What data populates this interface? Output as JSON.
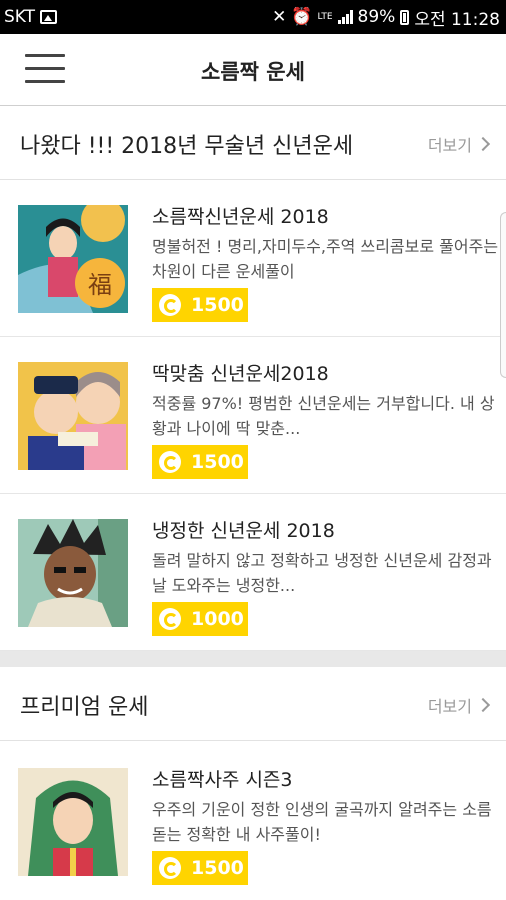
{
  "status_bar": {
    "carrier": "SKT",
    "lte": "LTE",
    "battery": "89%",
    "time": "오전 11:28"
  },
  "app_bar": {
    "title": "소름짝 운세"
  },
  "sections": [
    {
      "title": "나왔다 !!! 2018년 무술년 신년운세",
      "more": "더보기",
      "items": [
        {
          "title": "소름짝신년운세 2018",
          "desc": "명불허전 ! 명리,자미두수,주역 쓰리콤보로 풀어주는 차원이 다른  운세풀이",
          "price": "1500",
          "thumb_icon": "hanbok-woman-fortune-image"
        },
        {
          "title": "딱맞춤 신년운세2018",
          "desc": "적중률 97%! 평범한 신년운세는 거부합니다.  내 상황과 나이에 딱 맞춘...",
          "price": "1500",
          "thumb_icon": "couple-illustration-image"
        },
        {
          "title": "냉정한 신년운세 2018",
          "desc": "돌려 말하지 않고 정확하고 냉정한 신년운세 감정과 날 도와주는 냉정한...",
          "price": "1000",
          "thumb_icon": "old-man-illustration-image"
        }
      ]
    },
    {
      "title": "프리미엄 운세",
      "more": "더보기",
      "items": [
        {
          "title": "소름짝사주 시즌3",
          "desc": " 우주의 기운이 정한 인생의 굴곡까지 알려주는 소름돋는 정확한 내 사주풀이!",
          "price": "1500",
          "thumb_icon": "veiled-woman-illustration-image"
        }
      ]
    }
  ],
  "colors": {
    "accent": "#ffd400",
    "text": "#222222",
    "muted": "#9a9a9a"
  }
}
